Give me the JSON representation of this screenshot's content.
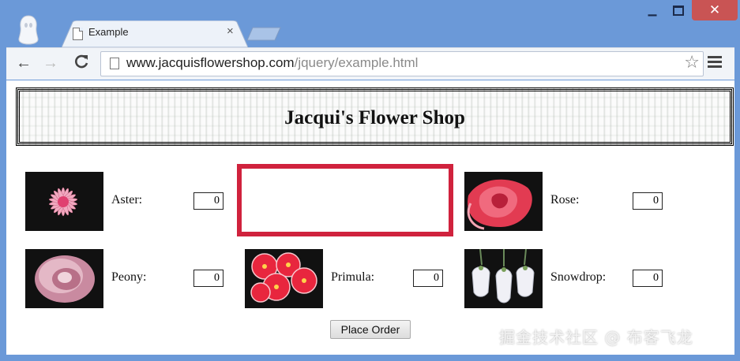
{
  "browser": {
    "tab_title": "Example",
    "tab_close": "×",
    "window_controls": {
      "minimize": "▁",
      "close": "✕"
    },
    "nav": {
      "back": "←",
      "forward": "→",
      "reload": "C"
    },
    "address": {
      "host": "www.jacquisflowershop.com",
      "path": "/jquery/example.html"
    },
    "icons": [
      "ghost-profile-icon",
      "page-icon",
      "star-icon",
      "menu-icon"
    ]
  },
  "page": {
    "heading": "Jacqui's Flower Shop",
    "flowers": [
      {
        "name": "Aster",
        "label": "Aster:",
        "qty": "0",
        "color": "#e06a8a"
      },
      {
        "name": "Rose",
        "label": "Rose:",
        "qty": "0",
        "color": "#e0304a"
      },
      {
        "name": "Peony",
        "label": "Peony:",
        "qty": "0",
        "color": "#d8a8b8"
      },
      {
        "name": "Primula",
        "label": "Primula:",
        "qty": "0",
        "color": "#e02a40"
      },
      {
        "name": "Snowdrop",
        "label": "Snowdrop:",
        "qty": "0",
        "color": "#e8e8f0"
      }
    ],
    "highlight_color": "#d0223d",
    "order_button": "Place Order"
  },
  "watermark": "掘金技术社区 @ 布客飞龙"
}
